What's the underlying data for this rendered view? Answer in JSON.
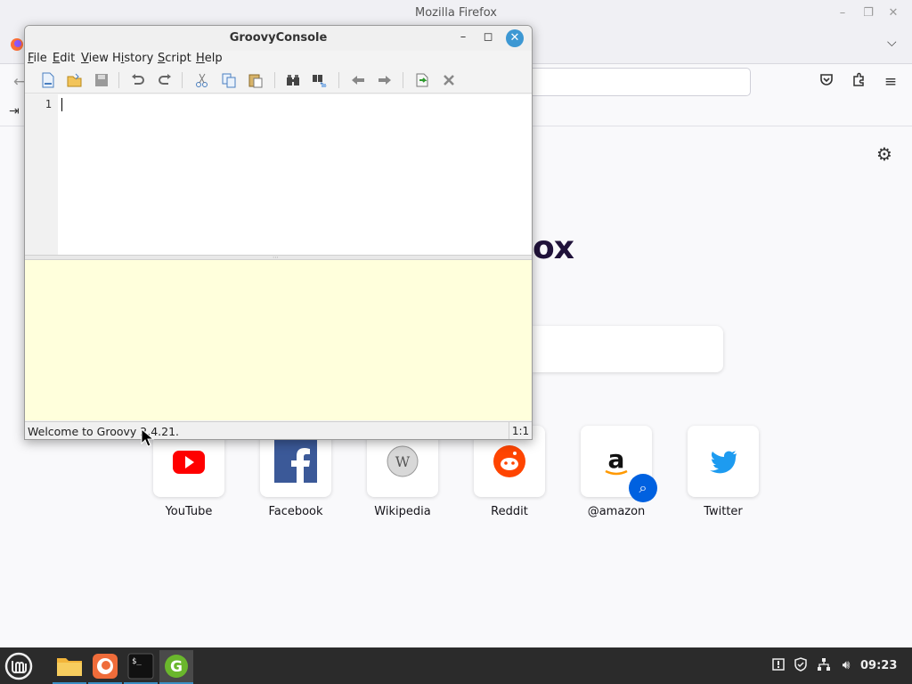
{
  "firefox": {
    "window_title": "Mozilla Firefox",
    "logo_text_fragment": "ox",
    "shortcuts": [
      {
        "label": "YouTube",
        "icon": "youtube-icon"
      },
      {
        "label": "Facebook",
        "icon": "facebook-icon"
      },
      {
        "label": "Wikipedia",
        "icon": "wikipedia-icon"
      },
      {
        "label": "Reddit",
        "icon": "reddit-icon"
      },
      {
        "label": "@amazon",
        "icon": "amazon-icon"
      },
      {
        "label": "Twitter",
        "icon": "twitter-icon"
      }
    ]
  },
  "groovy": {
    "title": "GroovyConsole",
    "menus": [
      {
        "label": "File",
        "mnemonic": "F"
      },
      {
        "label": "Edit",
        "mnemonic": "E"
      },
      {
        "label": "View",
        "mnemonic": "V"
      },
      {
        "label": "History",
        "mnemonic": "i"
      },
      {
        "label": "Script",
        "mnemonic": "S"
      },
      {
        "label": "Help",
        "mnemonic": "H"
      }
    ],
    "toolbar": [
      "new-file-icon",
      "open-file-icon",
      "save-icon",
      "undo-icon",
      "redo-icon",
      "cut-icon",
      "copy-icon",
      "paste-icon",
      "find-icon",
      "replace-icon",
      "previous-history-icon",
      "next-history-icon",
      "run-script-icon",
      "interrupt-icon"
    ],
    "editor": {
      "line_number": "1",
      "content": ""
    },
    "status": {
      "message": "Welcome to Groovy 2.4.21.",
      "caret_position": "1:1"
    }
  },
  "taskbar": {
    "apps": [
      "mint-menu-icon",
      "files-icon",
      "firefox-icon",
      "terminal-icon",
      "groovy-icon"
    ],
    "clock": "09:23"
  },
  "colors": {
    "output_background": "#ffffdc",
    "close_button": "#3d98d3",
    "taskbar": "#2b2b2b"
  }
}
